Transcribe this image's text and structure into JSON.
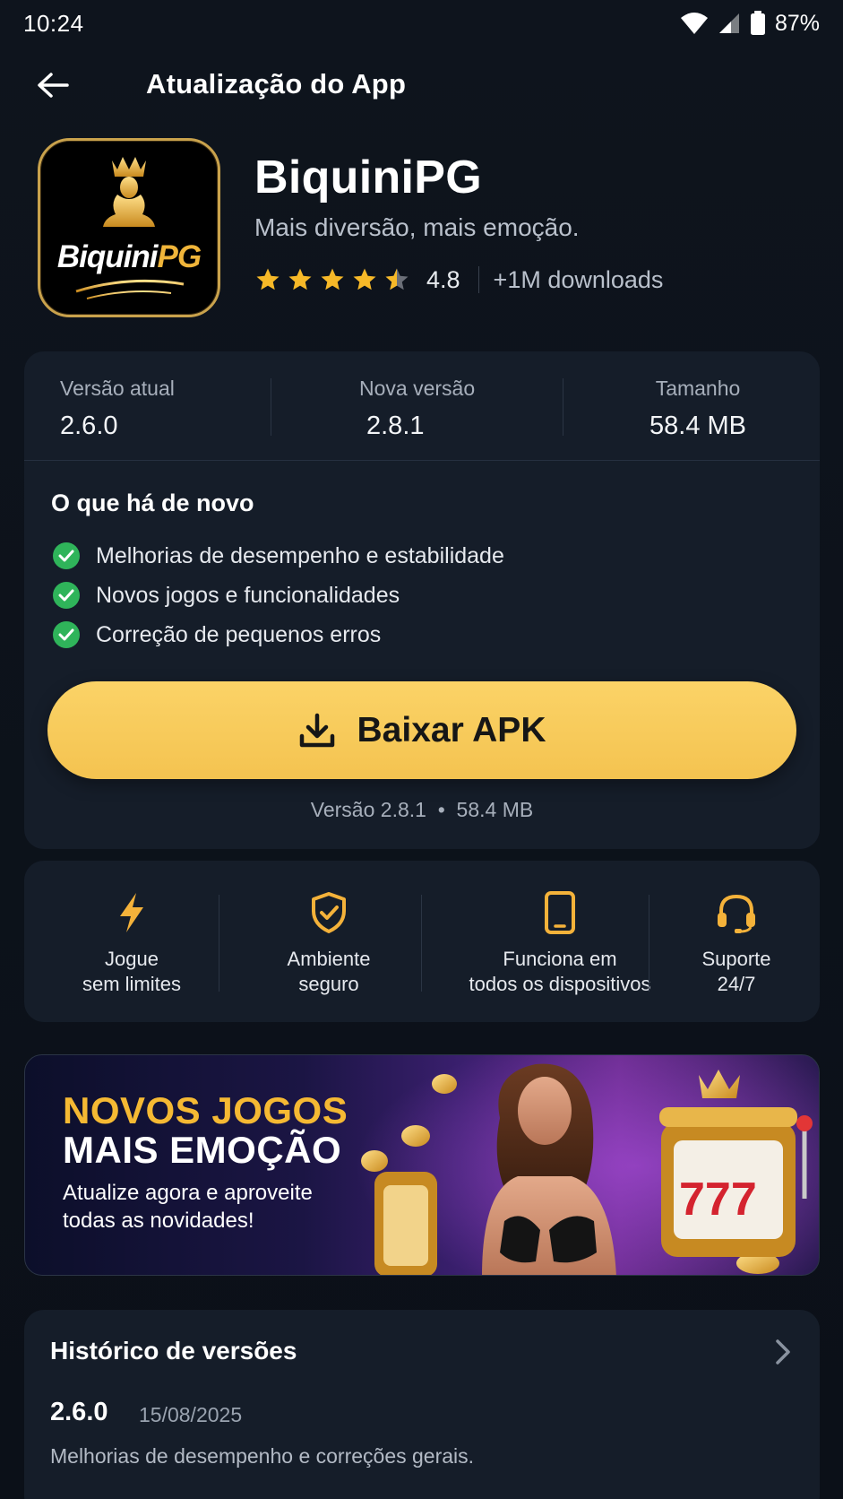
{
  "status_bar": {
    "time": "10:24",
    "battery": "87%"
  },
  "header": {
    "title": "Atualização do App"
  },
  "app": {
    "icon_text_white": "Biquini",
    "icon_text_gold": "PG",
    "name": "BiquiniPG",
    "tagline": "Mais diversão, mais emoção.",
    "rating": "4.8",
    "rating_stars": 4.5,
    "downloads": "+1M downloads"
  },
  "versions": {
    "current_label": "Versão atual",
    "current_value": "2.6.0",
    "new_label": "Nova versão",
    "new_value": "2.8.1",
    "size_label": "Tamanho",
    "size_value": "58.4 MB"
  },
  "whats_new": {
    "title": "O que há de novo",
    "items": [
      "Melhorias de desempenho e estabilidade",
      "Novos jogos e funcionalidades",
      "Correção de pequenos erros"
    ]
  },
  "download": {
    "label": "Baixar APK",
    "meta": "Versão 2.8.1  •  58.4 MB"
  },
  "features": [
    {
      "icon": "lightning-icon",
      "label": "Jogue\nsem limites"
    },
    {
      "icon": "shield-check-icon",
      "label": "Ambiente\nseguro"
    },
    {
      "icon": "smartphone-icon",
      "label": "Funciona em\ntodos os dispositivos"
    },
    {
      "icon": "headset-icon",
      "label": "Suporte\n24/7"
    }
  ],
  "promo": {
    "title_1": "NOVOS JOGOS",
    "title_2": "MAIS EMOÇÃO",
    "text": "Atualize agora e aproveite todas as novidades!",
    "slot_digits": "777"
  },
  "history": {
    "title": "Histórico de versões",
    "version": "2.6.0",
    "date": "15/08/2025",
    "description": "Melhorias de desempenho e correções gerais."
  },
  "colors": {
    "accent_gold": "#f4c350",
    "check_green": "#2fb45a",
    "star_gold": "#f7b928"
  }
}
